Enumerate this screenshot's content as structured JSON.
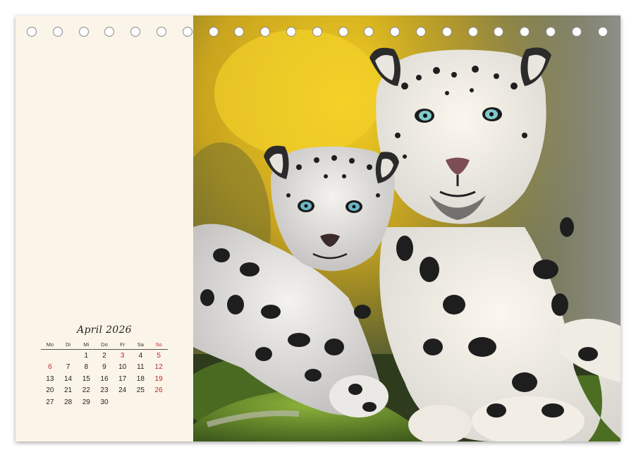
{
  "calendar": {
    "title": "April 2026",
    "weekdays": [
      "Mo",
      "Di",
      "Mi",
      "Do",
      "Fr",
      "Sa",
      "So"
    ],
    "weeks": [
      [
        "",
        "",
        "1",
        "2",
        "3",
        "4",
        "5"
      ],
      [
        "6",
        "7",
        "8",
        "9",
        "10",
        "11",
        "12"
      ],
      [
        "13",
        "14",
        "15",
        "16",
        "17",
        "18",
        "19"
      ],
      [
        "20",
        "21",
        "22",
        "23",
        "24",
        "25",
        "26"
      ],
      [
        "27",
        "28",
        "29",
        "30",
        "",
        "",
        ""
      ]
    ],
    "holidays": [
      "3",
      "5",
      "6"
    ],
    "holiday_color": "#c0282d"
  },
  "photo": {
    "subject": "snow-leopard-mother-and-cub",
    "background_colors": [
      "#e8c21c",
      "#5a6a2c",
      "#8c8d86"
    ]
  },
  "binding": {
    "hole_count": 23
  }
}
